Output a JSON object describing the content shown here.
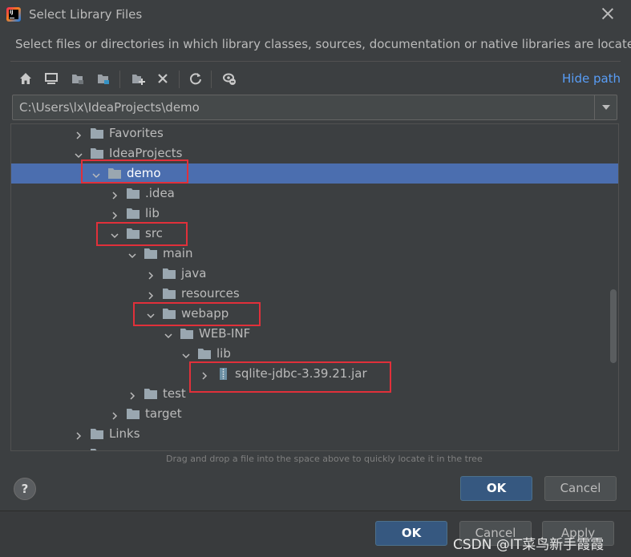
{
  "window": {
    "title": "Select Library Files",
    "description": "Select files or directories in which library classes, sources, documentation or native libraries are located"
  },
  "toolbar": {
    "icons": [
      "home-icon",
      "desktop-icon",
      "project-folder-icon",
      "module-folder-icon",
      "new-folder-icon",
      "delete-icon",
      "refresh-icon",
      "show-hidden-icon"
    ],
    "hide_path": "Hide path"
  },
  "path": {
    "value": "C:\\Users\\lx\\IdeaProjects\\demo"
  },
  "tree": {
    "rows": [
      {
        "label": "Favorites",
        "expanded": false,
        "icon": "folder-icon"
      },
      {
        "label": "IdeaProjects",
        "expanded": true,
        "icon": "folder-icon"
      },
      {
        "label": "demo",
        "expanded": true,
        "icon": "folder-icon",
        "selected": true
      },
      {
        "label": ".idea",
        "expanded": false,
        "icon": "folder-icon"
      },
      {
        "label": "lib",
        "expanded": false,
        "icon": "folder-icon"
      },
      {
        "label": "src",
        "expanded": true,
        "icon": "folder-icon"
      },
      {
        "label": "main",
        "expanded": true,
        "icon": "folder-icon"
      },
      {
        "label": "java",
        "expanded": false,
        "icon": "folder-icon"
      },
      {
        "label": "resources",
        "expanded": false,
        "icon": "folder-icon"
      },
      {
        "label": "webapp",
        "expanded": true,
        "icon": "folder-icon"
      },
      {
        "label": "WEB-INF",
        "expanded": true,
        "icon": "folder-icon"
      },
      {
        "label": "lib",
        "expanded": true,
        "icon": "folder-icon"
      },
      {
        "label": "sqlite-jdbc-3.39.21.jar",
        "expanded": false,
        "icon": "jar-icon"
      },
      {
        "label": "test",
        "expanded": false,
        "icon": "folder-icon"
      },
      {
        "label": "target",
        "expanded": false,
        "icon": "folder-icon"
      },
      {
        "label": "Links",
        "expanded": false,
        "icon": "folder-icon"
      }
    ]
  },
  "hint": "Drag and drop a file into the space above to quickly locate it in the tree",
  "buttons": {
    "help": "?",
    "ok": "OK",
    "cancel": "Cancel"
  },
  "background_dialog": {
    "ok": "OK",
    "cancel": "Cancel",
    "apply": "Apply"
  },
  "watermark": "CSDN @IT菜鸟新手霞霞",
  "colors": {
    "selection": "#4b6eaf",
    "link": "#589df6",
    "annotation": "#e1303a",
    "primary_button": "#365880"
  }
}
